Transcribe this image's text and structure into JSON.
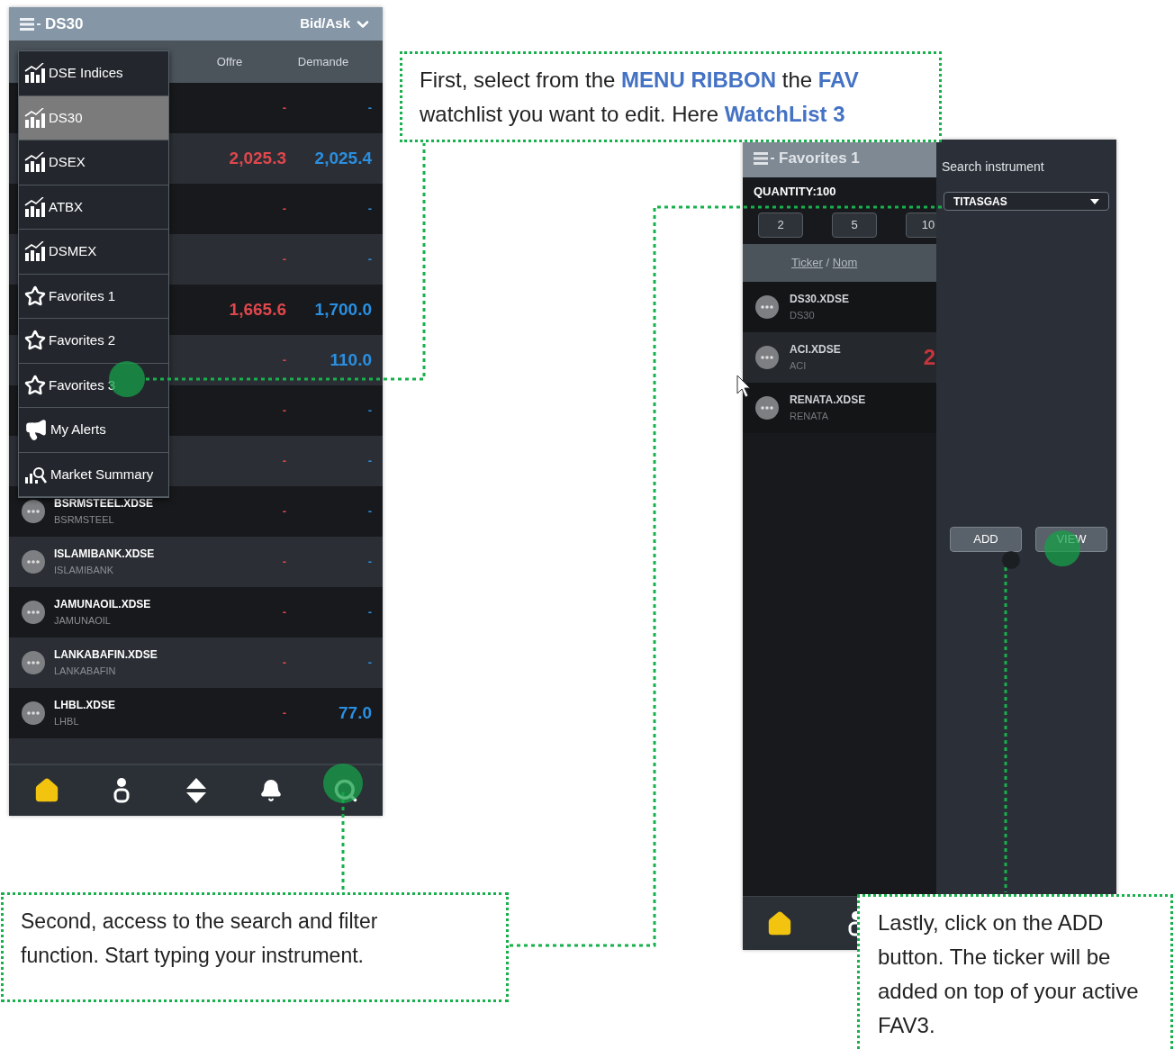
{
  "left_phone": {
    "header": {
      "title": "DS30",
      "view": "Bid/Ask"
    },
    "columns": [
      "Offre",
      "Demande"
    ],
    "rows": [
      {
        "offre": "-",
        "demande": "-"
      },
      {
        "offre": "2,025.3",
        "demande": "2,025.4"
      },
      {
        "offre": "-",
        "demande": "-"
      },
      {
        "offre": "-",
        "demande": "-"
      },
      {
        "offre": "1,665.6",
        "demande": "1,700.0"
      },
      {
        "offre": "-",
        "demande": "110.0"
      },
      {
        "offre": "-",
        "demande": "-"
      },
      {
        "offre": "-",
        "demande": "-"
      },
      {
        "ticker": "BSRMSTEEL.XDSE",
        "name": "BSRMSTEEL",
        "offre": "-",
        "demande": "-"
      },
      {
        "ticker": "ISLAMIBANK.XDSE",
        "name": "ISLAMIBANK",
        "offre": "-",
        "demande": "-"
      },
      {
        "ticker": "JAMUNAOIL.XDSE",
        "name": "JAMUNAOIL",
        "offre": "-",
        "demande": "-"
      },
      {
        "ticker": "LANKABAFIN.XDSE",
        "name": "LANKABAFIN",
        "offre": "-",
        "demande": "-"
      },
      {
        "ticker": "LHBL.XDSE",
        "name": "LHBL",
        "offre": "-",
        "demande": "77.0"
      }
    ],
    "menu": [
      {
        "kind": "index",
        "label": "DSE Indices",
        "selected": false
      },
      {
        "kind": "index",
        "label": "DS30",
        "selected": true
      },
      {
        "kind": "index",
        "label": "DSEX",
        "selected": false
      },
      {
        "kind": "index",
        "label": "ATBX",
        "selected": false
      },
      {
        "kind": "index",
        "label": "DSMEX",
        "selected": false
      },
      {
        "kind": "favorite",
        "label": "Favorites 1",
        "selected": false
      },
      {
        "kind": "favorite",
        "label": "Favorites 2",
        "selected": false
      },
      {
        "kind": "favorite",
        "label": "Favorites 3",
        "selected": false
      },
      {
        "kind": "alerts",
        "label": "My Alerts",
        "selected": false
      },
      {
        "kind": "summary",
        "label": "Market Summary",
        "selected": false
      }
    ],
    "nav": [
      {
        "kind": "home",
        "selected": true
      },
      {
        "kind": "account",
        "selected": false
      },
      {
        "kind": "trade",
        "selected": false
      },
      {
        "kind": "alerts",
        "selected": false
      },
      {
        "kind": "search",
        "selected": false
      }
    ]
  },
  "right_phone": {
    "header": {
      "title": "Favorites 1"
    },
    "quantity": "QUANTITY:100",
    "quantity_buttons": [
      "2",
      "5",
      "10"
    ],
    "column": {
      "ticker": "Ticker",
      "separator": "/",
      "name": "Nom"
    },
    "rows": [
      {
        "ticker": "DS30.XDSE",
        "name": "DS30"
      },
      {
        "ticker": "ACI.XDSE",
        "name": "ACI",
        "offre": "2"
      },
      {
        "ticker": "RENATA.XDSE",
        "name": "RENATA"
      }
    ],
    "search_panel": {
      "title": "Search instrument",
      "value": "TITASGAS",
      "buttons": [
        "ADD",
        "VIEW"
      ]
    },
    "nav": [
      {
        "kind": "home",
        "selected": true
      },
      {
        "kind": "account",
        "selected": false
      }
    ]
  },
  "callouts": [
    {
      "text": "First, select from the **MENU RIBBON** the **FAV** watchlist you want to edit. Here **WatchList 3**"
    },
    {
      "text": "Second, access to the search and filter function. Start typing your instrument."
    },
    {
      "text": "Lastly, click on the ADD button. The ticker will be added on top of your active FAV3."
    }
  ]
}
